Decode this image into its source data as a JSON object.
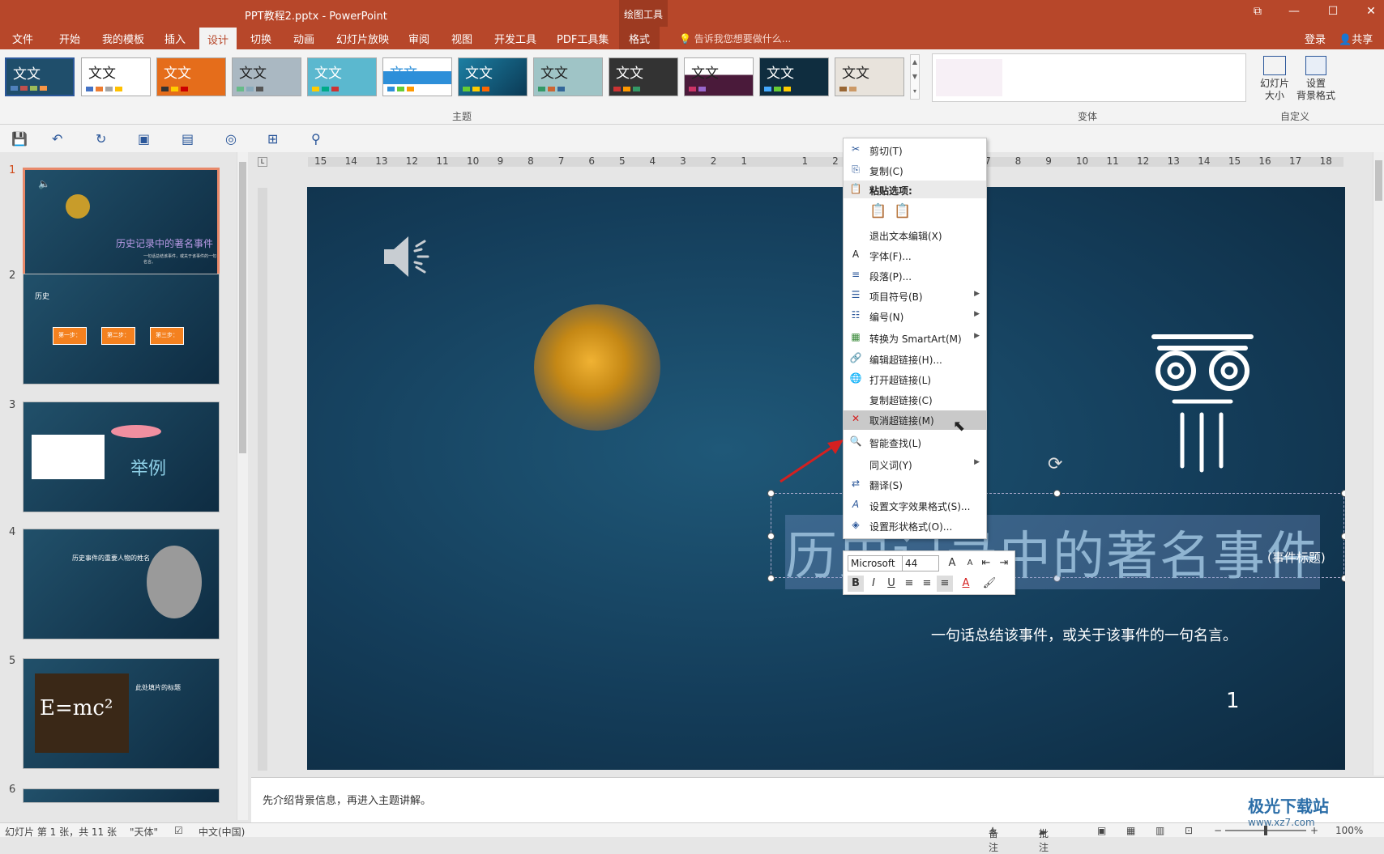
{
  "titlebar": {
    "title": "PPT教程2.pptx - PowerPoint",
    "context_label": "绘图工具",
    "min": "—",
    "max": "☐",
    "close": "✕",
    "restore": "⧉"
  },
  "tabs": [
    "文件",
    "开始",
    "我的模板",
    "插入",
    "设计",
    "切换",
    "动画",
    "幻灯片放映",
    "审阅",
    "视图",
    "开发工具",
    "PDF工具集",
    "格式"
  ],
  "active_tab": "设计",
  "tellme": "告诉我您想要做什么...",
  "login": "登录",
  "share": "共享",
  "ribbon": {
    "theme_sample": "文文",
    "themes_label": "主题",
    "variant_label": "变体",
    "custom_label": "自定义",
    "slide_size_label": "幻灯片\n大小",
    "format_bg_label": "设置\n背景格式"
  },
  "slides": [
    {
      "num": "1",
      "title": "历史记录中的著名事件",
      "sub": "一句话总结该事件，或关于该事件的一句名言。"
    },
    {
      "num": "2",
      "title": "历史",
      "steps": [
        "第一步：",
        "第二步：",
        "第三步："
      ]
    },
    {
      "num": "3",
      "title": "举例"
    },
    {
      "num": "4",
      "title": "历史事件的重要人物的姓名"
    },
    {
      "num": "5",
      "title": "此处填片的标题",
      "formula": "E=mc²"
    },
    {
      "num": "6"
    }
  ],
  "ruler_numbers": [
    "15",
    "14",
    "13",
    "12",
    "11",
    "10",
    "9",
    "8",
    "7",
    "6",
    "5",
    "4",
    "3",
    "2",
    "1",
    "",
    "1",
    "2",
    "",
    "",
    "",
    "",
    "7",
    "8",
    "9",
    "10",
    "11",
    "12",
    "13",
    "14",
    "15",
    "16",
    "17",
    "18"
  ],
  "main_slide": {
    "title": "历史记录中的著名事件",
    "title_tag": "(事件标题)",
    "quote": "一句话总结该事件，或关于该事件的一句名言。",
    "page_number": "1"
  },
  "context_menu": {
    "items": [
      {
        "label": "剪切(T)",
        "icon": "✂",
        "arrow": false
      },
      {
        "label": "复制(C)",
        "icon": "⎘",
        "arrow": false
      },
      {
        "label": "粘贴选项:",
        "icon": "📋",
        "arrow": false
      },
      {
        "label": "",
        "icon": "",
        "arrow": false
      },
      {
        "label": "退出文本编辑(X)",
        "icon": "",
        "arrow": false
      },
      {
        "label": "字体(F)...",
        "icon": "A",
        "arrow": false
      },
      {
        "label": "段落(P)...",
        "icon": "≡",
        "arrow": false
      },
      {
        "label": "项目符号(B)",
        "icon": "☰",
        "arrow": true
      },
      {
        "label": "编号(N)",
        "icon": "☷",
        "arrow": true
      },
      {
        "label": "转换为 SmartArt(M)",
        "icon": "▦",
        "arrow": true
      },
      {
        "label": "编辑超链接(H)...",
        "icon": "🔗",
        "arrow": false
      },
      {
        "label": "打开超链接(L)",
        "icon": "🌐",
        "arrow": false
      },
      {
        "label": "复制超链接(C)",
        "icon": "",
        "arrow": false
      },
      {
        "label": "取消超链接(M)",
        "icon": "✕",
        "arrow": false
      },
      {
        "label": "智能查找(L)",
        "icon": "🔍",
        "arrow": false
      },
      {
        "label": "同义词(Y)",
        "icon": "",
        "arrow": true
      },
      {
        "label": "翻译(S)",
        "icon": "⇄",
        "arrow": false
      },
      {
        "label": "设置文字效果格式(S)...",
        "icon": "A",
        "arrow": false
      },
      {
        "label": "设置形状格式(O)...",
        "icon": "◈",
        "arrow": false
      }
    ]
  },
  "minibar": {
    "font": "Microsoft",
    "size": "44",
    "bold": "B",
    "italic": "I",
    "underline": "U",
    "grow": "A",
    "shrink": "A"
  },
  "notes": "先介绍背景信息，再进入主题讲解。",
  "status": {
    "slide_info": "幻灯片 第 1 张，共 11 张",
    "theme": "\"天体\"",
    "language": "中文(中国)",
    "notes_btn": "备注",
    "comments_btn": "批注",
    "zoom": "100%"
  },
  "watermark": {
    "title": "极光下载站",
    "url": "www.xz7.com"
  },
  "colors": {
    "accent": "#b7472a",
    "slide_bg": "#143d5a"
  }
}
